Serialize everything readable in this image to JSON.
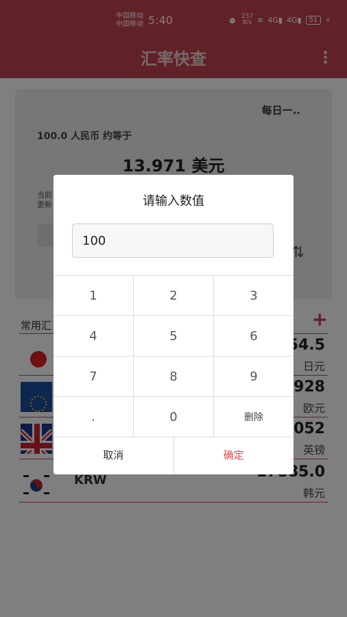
{
  "status_bar": {
    "carrier_1": "中国移动",
    "carrier_2": "中国移动",
    "time": "5:40",
    "net_speed_value": "257",
    "net_speed_unit": "B/s",
    "signal_1": "4G",
    "signal_2": "4G",
    "battery": "51"
  },
  "app_bar": {
    "title": "汇率快查"
  },
  "card": {
    "daily_label": "每日一..",
    "amount_line": "100.0 人民币 约等于",
    "result": "13.971 美元",
    "info_line1": "当前",
    "info_line2": "更新"
  },
  "list": {
    "title": "常用汇",
    "rows": [
      {
        "code": "",
        "value": "54.5",
        "unit": "日元",
        "flag": "japan-flag-icon"
      },
      {
        "code": "",
        "value": "928",
        "unit": "欧元",
        "flag": "eu-flag-icon"
      },
      {
        "code": "",
        "value": "052",
        "unit": "英镑",
        "flag": "uk-flag-icon"
      },
      {
        "code": "KRW",
        "value": "17885.0",
        "unit": "韩元",
        "flag": "korea-flag-icon"
      }
    ]
  },
  "dialog": {
    "title": "请输入数值",
    "input_value": "100",
    "keys": [
      [
        "1",
        "2",
        "3"
      ],
      [
        "4",
        "5",
        "6"
      ],
      [
        "7",
        "8",
        "9"
      ],
      [
        ".",
        "0",
        "删除"
      ]
    ],
    "cancel": "取消",
    "confirm": "确定"
  },
  "colors": {
    "primary": "#c0424f",
    "confirm": "#e04a4a",
    "overlay": "rgba(0,0,0,0.5)"
  }
}
